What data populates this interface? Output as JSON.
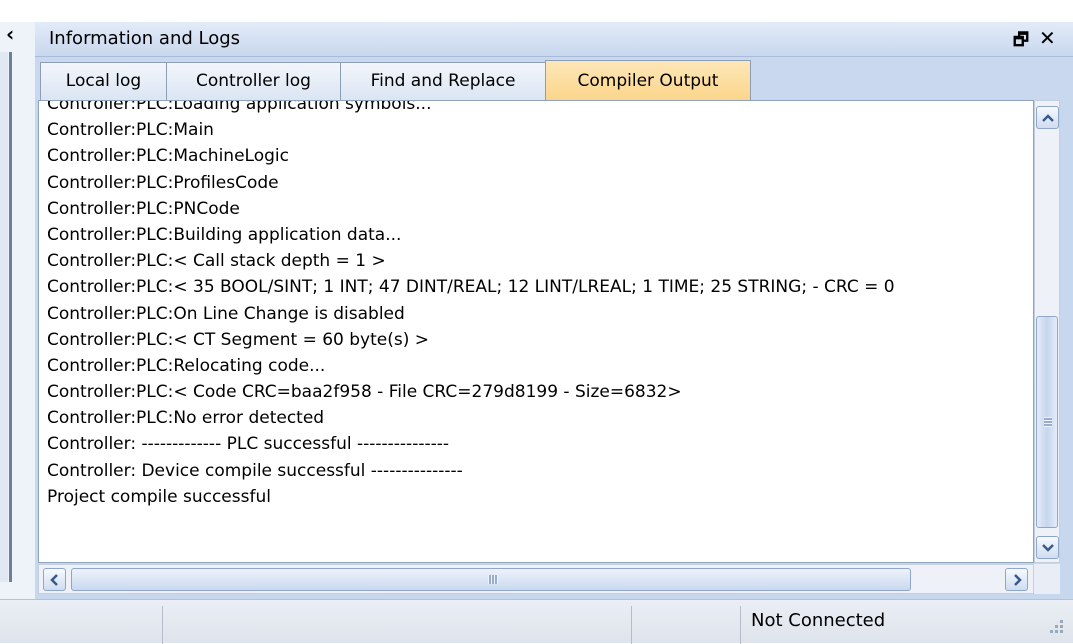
{
  "panel": {
    "title": "Information and Logs",
    "collapse_glyph": "‹",
    "float_glyph": "🗗",
    "close_glyph": "✕"
  },
  "tabs": [
    {
      "label": "Local log",
      "active": false
    },
    {
      "label": "Controller log",
      "active": false
    },
    {
      "label": "Find and Replace",
      "active": false
    },
    {
      "label": "Compiler Output",
      "active": true
    }
  ],
  "log": {
    "lines": [
      "Controller:PLC:Loading application symbols...",
      "Controller:PLC:Main",
      "Controller:PLC:MachineLogic",
      "Controller:PLC:ProfilesCode",
      "Controller:PLC:PNCode",
      "Controller:PLC:Building application data...",
      "Controller:PLC:< Call stack depth = 1 >",
      "Controller:PLC:< 35 BOOL/SINT; 1 INT; 47 DINT/REAL; 12 LINT/LREAL; 1 TIME; 25 STRING;  - CRC = 0",
      "Controller:PLC:On Line Change is disabled",
      "Controller:PLC:< CT Segment = 60 byte(s) >",
      "Controller:PLC:Relocating code...",
      "Controller:PLC:< Code CRC=baa2f958 - File CRC=279d8199 - Size=6832>",
      "Controller:PLC:No error detected",
      "Controller: ------------- PLC successful ---------------",
      "Controller:  Device compile  successful ---------------",
      "Project compile successful"
    ]
  },
  "status": {
    "connection": "Not Connected"
  },
  "icons": {
    "collapse": "chevron-left-icon",
    "float": "float-window-icon",
    "close": "close-icon",
    "scroll_up": "arrow-up-icon",
    "scroll_down": "arrow-down-icon",
    "scroll_left": "arrow-left-icon",
    "scroll_right": "arrow-right-icon",
    "resize": "resize-grip-icon"
  },
  "colors": {
    "active_tab": "#fbd58a",
    "panel_background": "#c7d7ee"
  }
}
